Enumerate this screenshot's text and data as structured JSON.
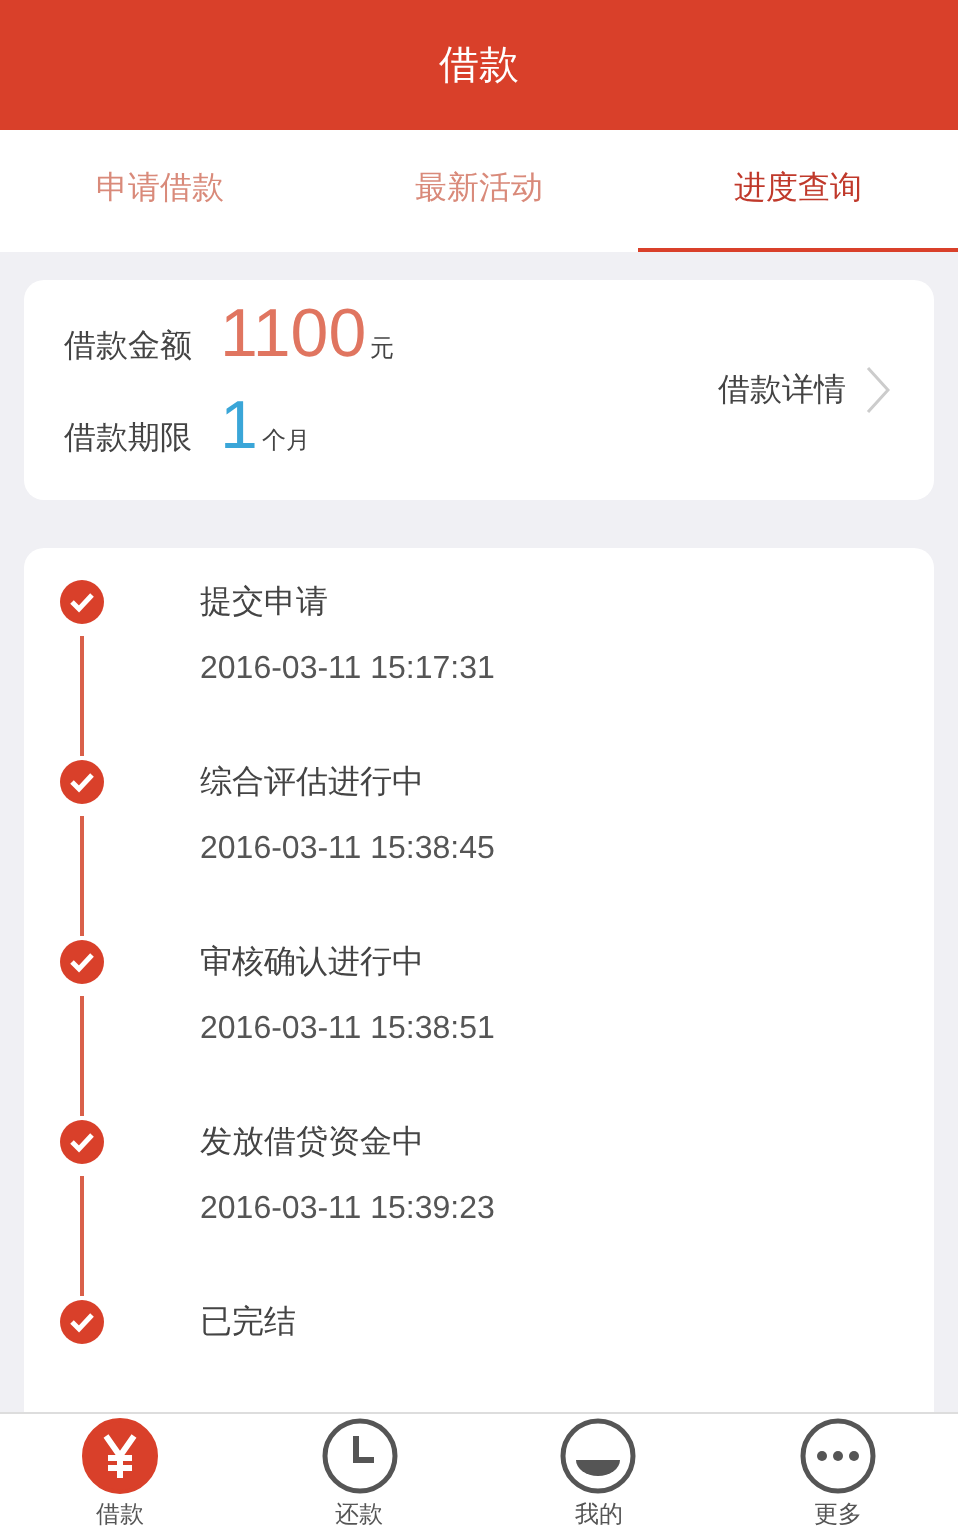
{
  "header": {
    "title": "借款"
  },
  "tabs": [
    {
      "label": "申请借款",
      "selected": false
    },
    {
      "label": "最新活动",
      "selected": false
    },
    {
      "label": "进度查询",
      "selected": true
    }
  ],
  "summary": {
    "amount_label": "借款金额",
    "amount": "1100",
    "amount_unit": "元",
    "term_label": "借款期限",
    "term": "1",
    "term_unit": "个月",
    "detail_link": "借款详情"
  },
  "progress": [
    {
      "title": "提交申请",
      "time": "2016-03-11 15:17:31",
      "done": true
    },
    {
      "title": "综合评估进行中",
      "time": "2016-03-11 15:38:45",
      "done": true
    },
    {
      "title": "审核确认进行中",
      "time": "2016-03-11 15:38:51",
      "done": true
    },
    {
      "title": "发放借贷资金中",
      "time": "2016-03-11 15:39:23",
      "done": true
    },
    {
      "title": "已完结",
      "done": true
    }
  ],
  "nav": [
    {
      "label": "借款",
      "kind": "yen",
      "selected": true
    },
    {
      "label": "还款",
      "kind": "clock",
      "selected": false
    },
    {
      "label": "我的",
      "kind": "face",
      "selected": false
    },
    {
      "label": "更多",
      "kind": "more",
      "selected": false
    }
  ]
}
